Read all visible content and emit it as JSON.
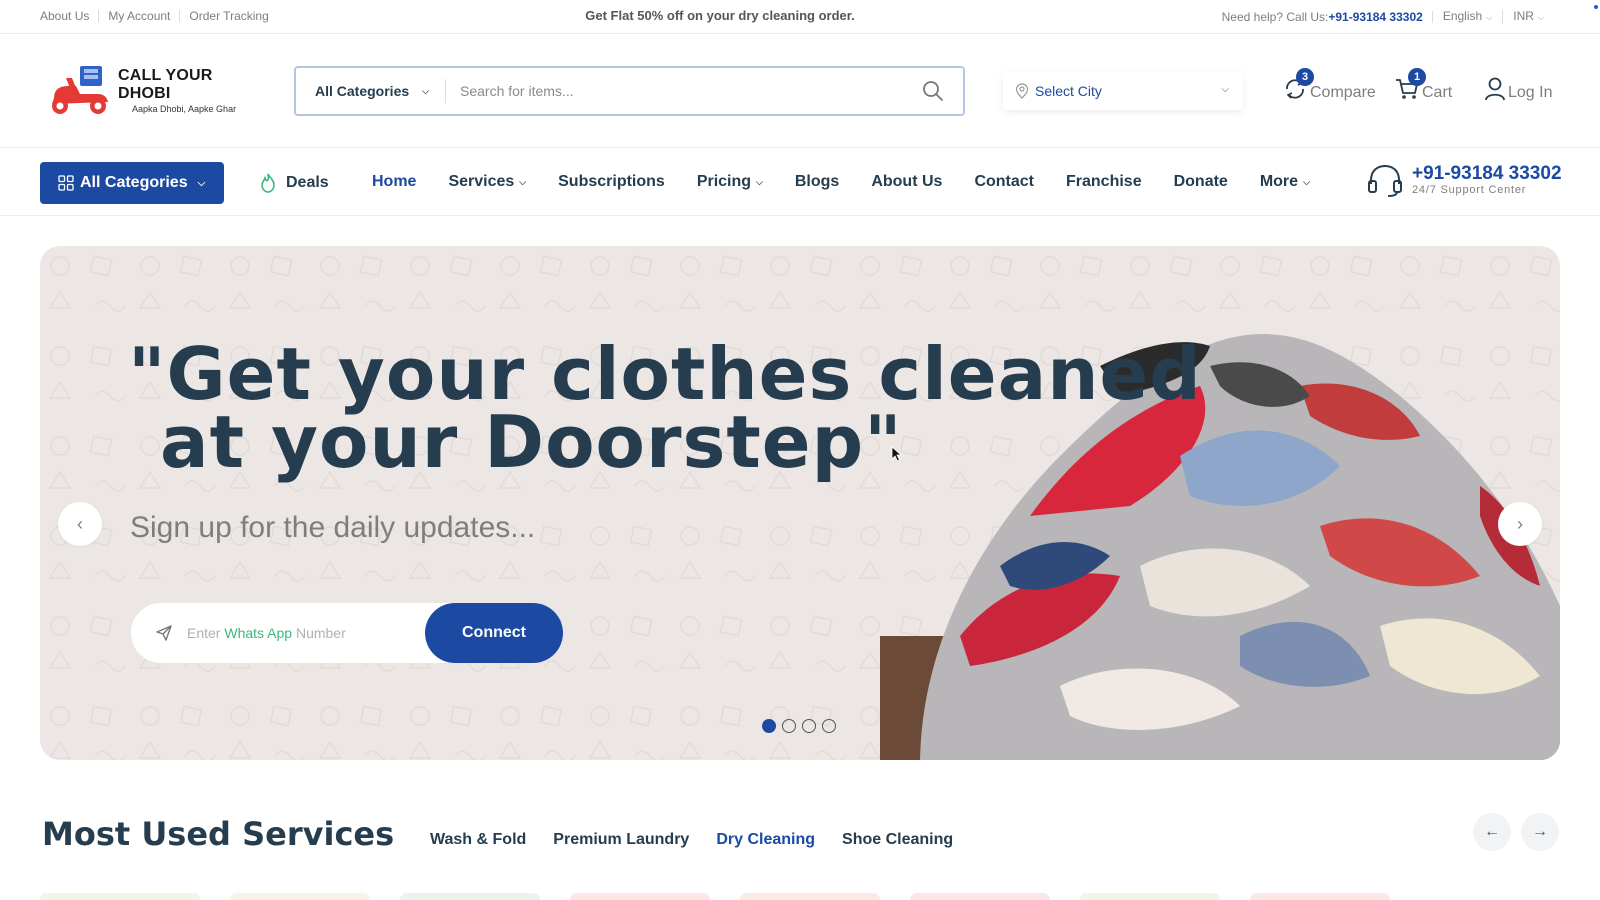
{
  "topbar": {
    "links": [
      "About Us",
      "My Account",
      "Order Tracking"
    ],
    "promo": "Get Flat 50% off on your dry cleaning order.",
    "help_prefix": "Need help? Call Us:",
    "help_phone": "+91-93184 33302",
    "language": "English",
    "currency": "INR"
  },
  "header": {
    "logo_title": "CALL YOUR DHOBI",
    "logo_tagline": "Aapka Dhobi, Aapke Ghar",
    "search_category": "All Categories",
    "search_placeholder": "Search for items...",
    "city_placeholder": "Select City",
    "compare_label": "Compare",
    "compare_count": "3",
    "cart_label": "Cart",
    "cart_count": "1",
    "login_label": "Log In"
  },
  "nav": {
    "all_categories": "All Categories",
    "deals": "Deals",
    "links": [
      {
        "label": "Home",
        "active": true,
        "dropdown": false
      },
      {
        "label": "Services",
        "active": false,
        "dropdown": true
      },
      {
        "label": "Subscriptions",
        "active": false,
        "dropdown": false
      },
      {
        "label": "Pricing",
        "active": false,
        "dropdown": true
      },
      {
        "label": "Blogs",
        "active": false,
        "dropdown": false
      },
      {
        "label": "About Us",
        "active": false,
        "dropdown": false
      },
      {
        "label": "Contact",
        "active": false,
        "dropdown": false
      },
      {
        "label": "Franchise",
        "active": false,
        "dropdown": false
      },
      {
        "label": "Donate",
        "active": false,
        "dropdown": false
      },
      {
        "label": "More",
        "active": false,
        "dropdown": true
      }
    ],
    "support_phone": "+91-93184 33302",
    "support_sub": "24/7 Support Center"
  },
  "hero": {
    "title_line1": "\"Get your clothes cleaned",
    "title_line2": "at your Doorstep\"",
    "subtitle": "Sign up for the daily updates...",
    "input_placeholder_start": "Enter",
    "input_placeholder_highlight": "Whats App",
    "input_placeholder_end": "Number",
    "connect_label": "Connect",
    "slide_count": 4,
    "active_slide": 1
  },
  "most_used": {
    "title": "Most Used Services",
    "tabs": [
      "Wash & Fold",
      "Premium Laundry",
      "Dry Cleaning",
      "Shoe Cleaning"
    ],
    "active_tab": "Dry Cleaning"
  },
  "colors": {
    "primary": "#1c4aa3",
    "heading": "#253d4e",
    "muted": "#7e7e7e",
    "hero_bg": "#ece7e5",
    "accent_green": "#3bb77e"
  }
}
